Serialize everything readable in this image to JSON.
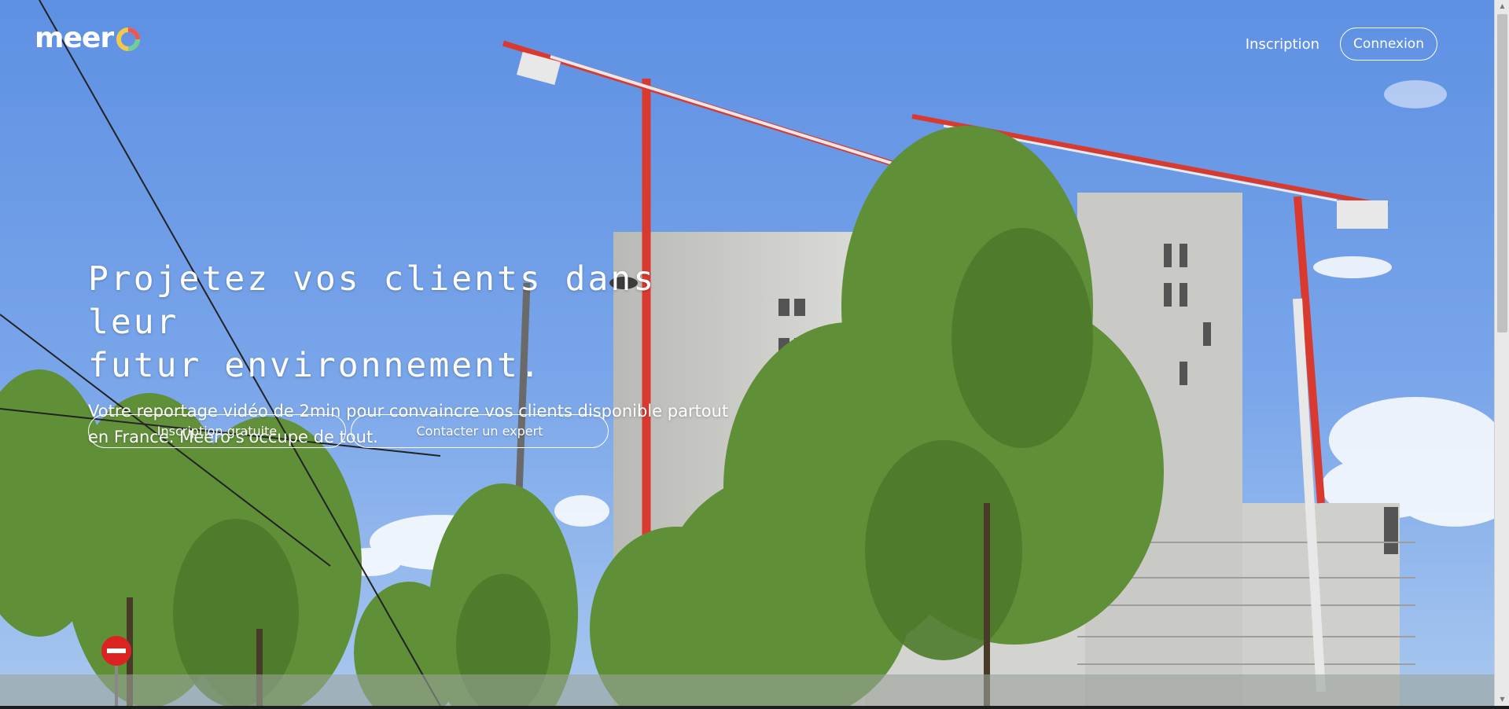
{
  "brand": {
    "logo_text": "meero",
    "logo_icon": "meero-logo"
  },
  "nav": {
    "signup_label": "Inscription",
    "login_label": "Connexion"
  },
  "hero": {
    "headline_line1": "Projetez vos clients dans leur",
    "headline_line2": "futur environnement.",
    "sub_line1": "Votre reportage vidéo de 2min pour convaincre vos clients disponible partout",
    "sub_line2": "en France. Meero s'occupe de tout.",
    "background_icon": "construction-site-photo"
  },
  "cta": {
    "primary_label": "Inscription gratuite",
    "secondary_label": "Contacter un expert"
  },
  "colors": {
    "sky": "#6f9ce4",
    "crane_red": "#d93a2f",
    "tree_green": "#5f8f37",
    "text": "#ffffff"
  }
}
